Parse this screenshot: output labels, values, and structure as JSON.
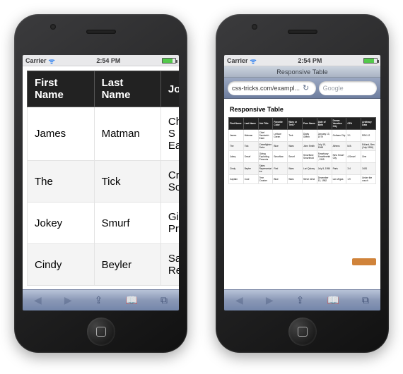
{
  "status": {
    "carrier": "Carrier",
    "time": "2:54 PM"
  },
  "browser": {
    "title": "Responsive Table",
    "url": "css-tricks.com/exampl...",
    "search_placeholder": "Google"
  },
  "page_title": "Responsive Table",
  "table": {
    "headers": [
      "First Name",
      "Last Name",
      "Job Title",
      "Favorite Color",
      "Wars or Trek?",
      "Porn Name",
      "Date of Birth",
      "Dream Vacation City",
      "GPA",
      "Arbitrary Data"
    ],
    "left_headers": [
      "First Name",
      "Last Name",
      "Job T"
    ],
    "rows": [
      [
        "James",
        "Matman",
        "Chief Sandwich Eater",
        "Lettuce Green",
        "Trek",
        "Digby Green",
        "January 13, 1979",
        "Gotham City",
        "3.1",
        "RBX-12"
      ],
      [
        "The",
        "Tick",
        "Crimefighter Sorta",
        "Blue",
        "Wars",
        "John Smith",
        "July 19, 1968",
        "Athens",
        "N/A",
        "Edlund, Ben (July 1996)"
      ],
      [
        "Jokey",
        "Smurf",
        "Giving Exploding Presents",
        "Smurflow",
        "Smurf",
        "Smurflane Smurfmutt",
        "Smurfuary Smurfteenth, 1945",
        "New Smurf City",
        "4.Smurf",
        "One"
      ],
      [
        "Cindy",
        "Beyler",
        "Sales Representative",
        "Red",
        "Wars",
        "Lori Quivey",
        "July 5, 1956",
        "Paris",
        "3.4",
        "3451"
      ],
      [
        "Captain",
        "Cool",
        "Tree Crusher",
        "Blue",
        "Wars",
        "Steve 42nd",
        "December 13, 1982",
        "Las Vegas",
        "1.9",
        "Under the couch"
      ]
    ],
    "left_rows": [
      [
        "James",
        "Matman",
        "Chief S\nEater"
      ],
      [
        "The",
        "Tick",
        "Crimef\nSorta"
      ],
      [
        "Jokey",
        "Smurf",
        "Giving\nPresen"
      ],
      [
        "Cindy",
        "Beyler",
        "Sales\nRepres"
      ]
    ]
  }
}
